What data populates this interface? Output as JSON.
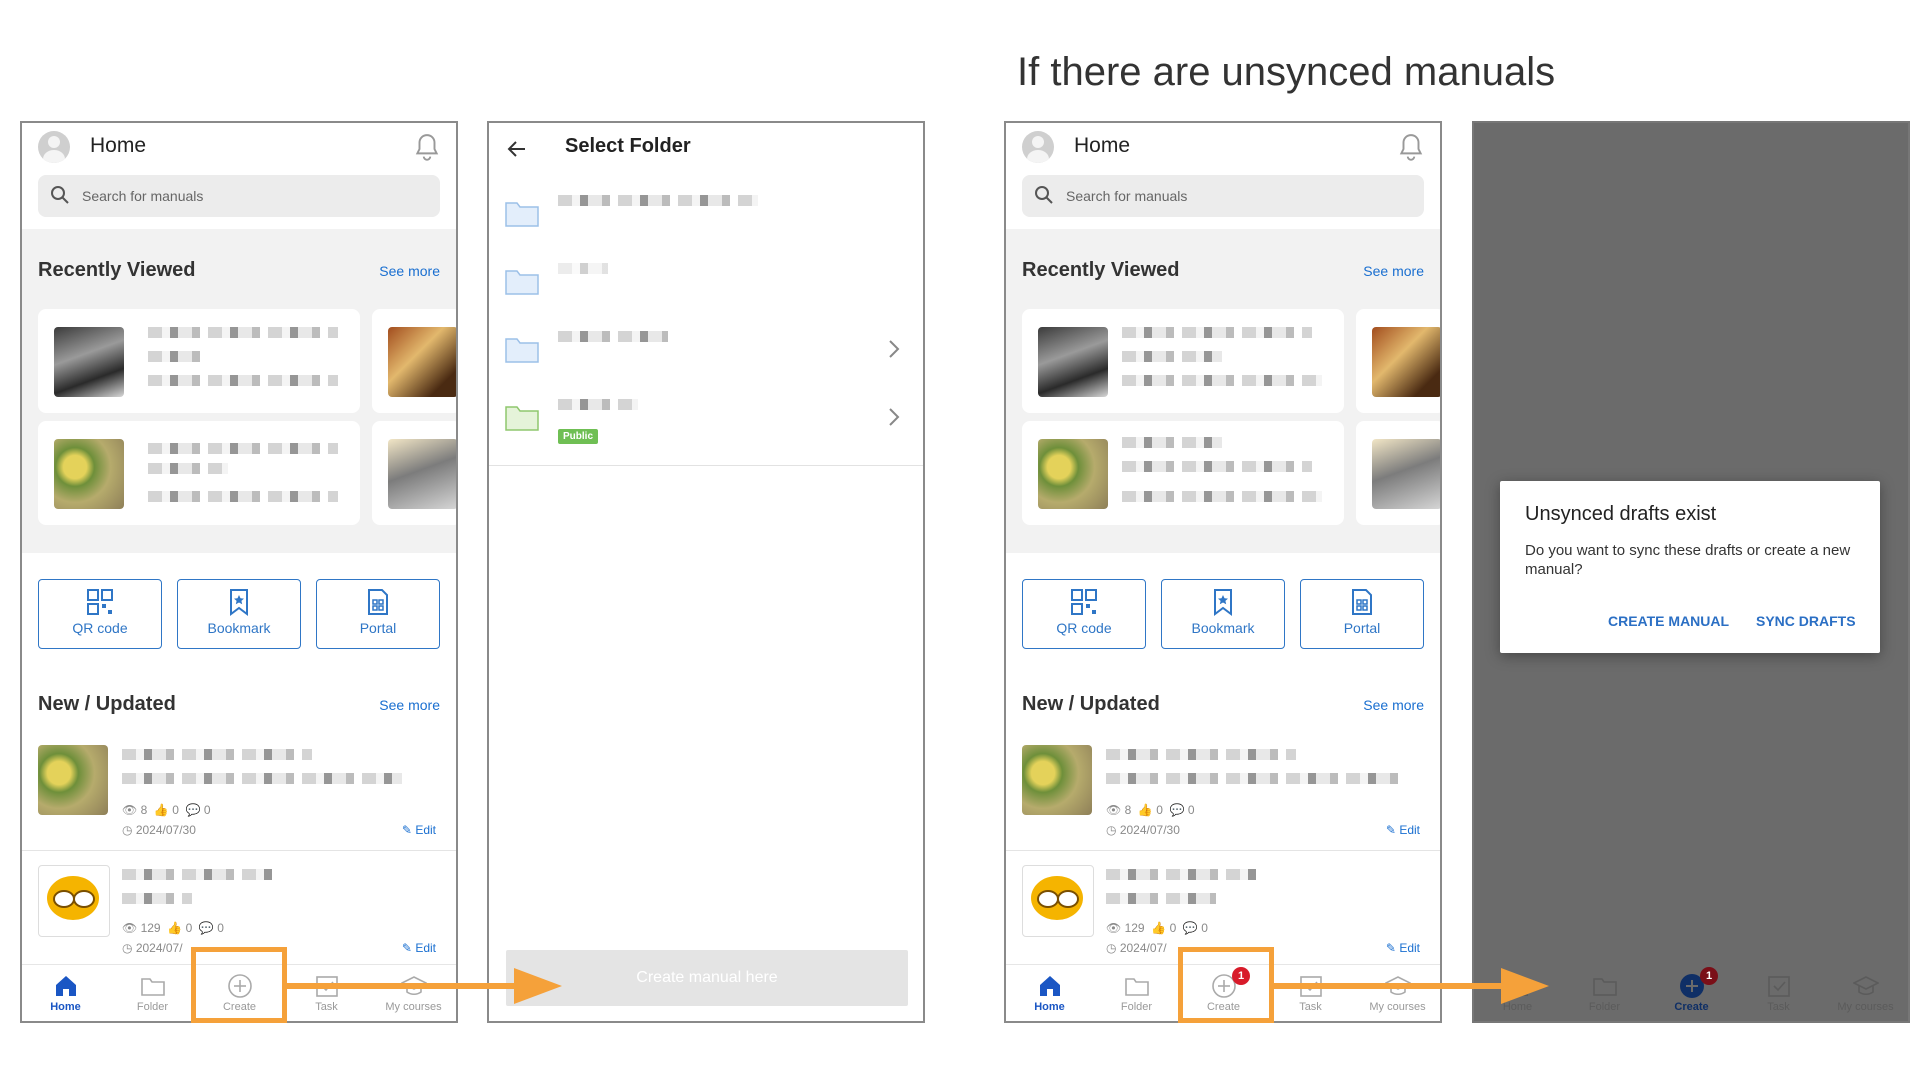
{
  "heading": "If there are unsynced manuals",
  "home": {
    "title": "Home",
    "search_placeholder": "Search for manuals",
    "recently_viewed": "Recently Viewed",
    "see_more": "See more",
    "quick": [
      {
        "label": "QR code",
        "icon": "qr-code-icon"
      },
      {
        "label": "Bookmark",
        "icon": "bookmark-icon"
      },
      {
        "label": "Portal",
        "icon": "portal-icon"
      }
    ],
    "new_updated": "New / Updated",
    "items": [
      {
        "views": "8",
        "likes": "0",
        "comments": "0",
        "date": "2024/07/30",
        "edit": "Edit"
      },
      {
        "views": "129",
        "likes": "0",
        "comments": "0",
        "date": "2024/07/",
        "edit": "Edit"
      }
    ],
    "nav": [
      {
        "label": "Home",
        "icon": "home-icon"
      },
      {
        "label": "Folder",
        "icon": "folder-icon"
      },
      {
        "label": "Create",
        "icon": "create-icon"
      },
      {
        "label": "Task",
        "icon": "task-icon"
      },
      {
        "label": "My courses",
        "icon": "courses-icon"
      }
    ],
    "create_badge": "1"
  },
  "select_folder": {
    "title": "Select Folder",
    "public_tag": "Public",
    "create_here": "Create manual here"
  },
  "dialog": {
    "title": "Unsynced drafts exist",
    "body": "Do you want to sync these drafts or create a new manual?",
    "create_manual": "CREATE MANUAL",
    "sync_drafts": "SYNC DRAFTS"
  },
  "colors": {
    "accent": "#1a6fd0",
    "highlight": "#f5a13a",
    "badge": "#d81b2a"
  }
}
